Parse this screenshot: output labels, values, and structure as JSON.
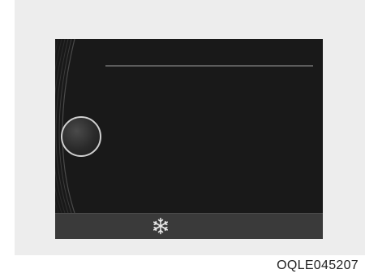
{
  "display": {
    "icons": {
      "bottom_bar_icon": "snowflake-icon",
      "knob": "dial-knob"
    },
    "colors": {
      "screen_background": "#191919",
      "bottom_bar": "#3a3a3a",
      "icon": "#e8e8e8",
      "frame": "#ededed"
    }
  },
  "caption": {
    "code": "OQLE045207"
  }
}
